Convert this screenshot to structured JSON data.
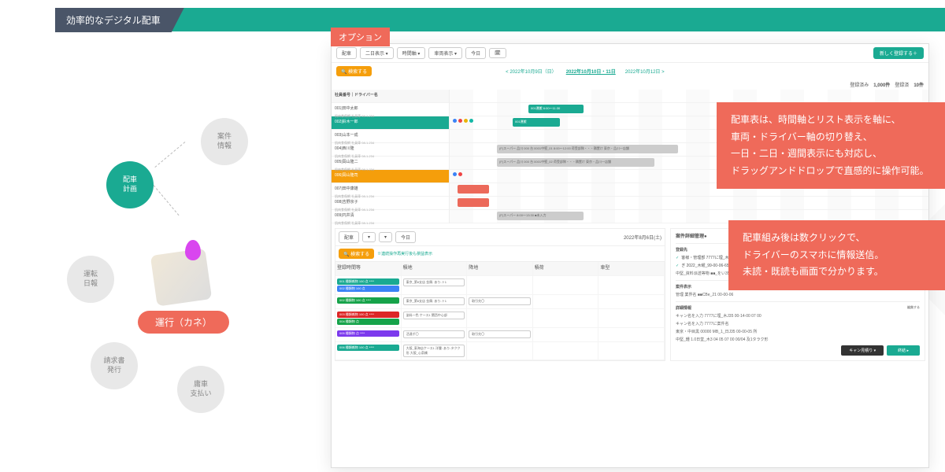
{
  "banner_title": "効率的なデジタル配車",
  "option_label": "オプション",
  "diagram": {
    "n1": "案件\n情報",
    "n2": "配車\n計画",
    "n3": "運転\n日報",
    "n4": "請求書\n発行",
    "n5": "庸車\n支払い",
    "center_pill": "運行（カネ）"
  },
  "shot": {
    "toolbar": {
      "mode": "配車",
      "t1": "二日表示 ▾",
      "t2": "時間軸 ▾",
      "t3": "車両表示 ▾",
      "t4": "今日",
      "cal_icon": "calendar-icon",
      "new_btn": "新しく登録する＋"
    },
    "search_btn": "検索する",
    "dates": {
      "d1": "< 2022年10月9日（日）",
      "d2": "2022年10月10日・11日",
      "d3": "2022年10月12日 >"
    },
    "meta": {
      "a": "登録済み",
      "a_val": "1,000件",
      "b": "登録済",
      "b_val": "10件"
    },
    "col_head": "社員番号｜ドライバー名",
    "rows": [
      {
        "name": "001|田中太郎",
        "sub": "肌肉食傷網 社員車 08-1-234"
      },
      {
        "name": "002|鈴木一郎",
        "sub": "肌肉食傷網 社員車 08-1-234"
      },
      {
        "name": "003|山本一成",
        "sub": "肌肉食傷網 社員車 08-1-234"
      },
      {
        "name": "004|西川隆",
        "sub": "肌肉食傷網 社員車 08-1-234"
      },
      {
        "name": "005|岡山隆二",
        "sub": "肌肉食傷網 社員車 08-1-234"
      },
      {
        "name": "006|岡山隆司",
        "sub": "肌肉食傷網 社員車 08-1-234"
      },
      {
        "name": "007|田中康雄",
        "sub": "肌肉食傷網 社員車 08-1-234"
      },
      {
        "name": "008|吉野京子",
        "sub": "肌肉食傷網 社員車 08-1-234"
      },
      {
        "name": "009|円井清",
        "sub": "肌肉食傷網 社員車 08-1-234"
      }
    ],
    "bars": {
      "b1": "001運搬  6:00～11:30",
      "b2": "001運搬",
      "b3": "(F)スーパー  品川 000 台 0001中堅_01  8:00～12:00  荷受部隊・・・積置け 東京・品川一店舗",
      "b4": "(F)スーパー  品川 000 台 0001中堅_02  荷受部隊・・・積置け 東京・品川一店舗",
      "b5": "(F)スーパー  8:00～13:30 ■未入力"
    },
    "cards_area": {
      "title_left": "配車",
      "filter": "検索する",
      "notice": "※連続操作再実行後も損益表示",
      "date2": "2022年8月6日(土)",
      "hdr": [
        "登録時間等",
        "積地",
        "降地",
        "積荷",
        "車型"
      ],
      "cards": [
        {
          "cls": "cd-teal",
          "t": "001 種類雑物 100 点  ****"
        },
        {
          "cls": "cd-blue",
          "t": "002 種類物 100 点"
        },
        {
          "cls": "outline",
          "t": "東京_第6支店  金属: あり-ト1"
        },
        {
          "cls": "cd-green",
          "t": "002 種類物 100 点  ****"
        },
        {
          "cls": "outline",
          "t": "東京_第6支店  金属: あり-ト1"
        },
        {
          "cls": "cd-red",
          "t": "003 種類雑物 100 点  ****"
        },
        {
          "cls": "cd-green",
          "t": "004 種類物 点"
        },
        {
          "cls": "outline",
          "t": "塗料一色  ケース1  関西中心部"
        },
        {
          "cls": "cd-purple",
          "t": "005 種類物 点  ****"
        },
        {
          "cls": "outline",
          "t": "活達ポ〇"
        },
        {
          "cls": "cd-teal",
          "t": "006 種類雑物 100 点  ****"
        },
        {
          "cls": "outline",
          "t": "大阪_東海店ケース1  洋畳: あり-タクク形 大阪_心斎橋"
        }
      ]
    },
    "detail": {
      "title": "案件詳細管理●",
      "sect1": "登録先",
      "c1": "客様・管理部  7777に埋_木J35 00-00-05",
      "c2": "ぎ  2022_木曜_99-00-06-65",
      "mid": "中堅_資料派送等物  ■■_をい35 03-110-00 岡山様向-くクラク後等",
      "sect2": "案件表示",
      "edit": "編集する",
      "f1": "管理 業界名  ■■CBe_21  00-00-06",
      "sect3": "詳細情報",
      "f2": "キャン名を入力  7777に埋_木J35 00-14-00 07 00",
      "f3": "キャン名を入力  7777に案件名",
      "f4": "東京・中目黒  00000 MB_1_日J35 00-00-05 所",
      "f5": "中堅_鍾  1.0日堂_木3 04 05 07 00 00/04 及1タラク形",
      "btn1": "キャン見積り ▾",
      "btn2": "終結 ▸"
    }
  },
  "callout_a": "配車表は、時間軸とリスト表示を軸に、\n車両・ドライバー軸の切り替え、\n一日・二日・週間表示にも対応し、\nドラッグアンドドロップで直感的に操作可能。",
  "callout_b": "配車組み後は数クリックで、\nドライバーのスマホに情報送信。\n未読・既読も画面で分かります。"
}
